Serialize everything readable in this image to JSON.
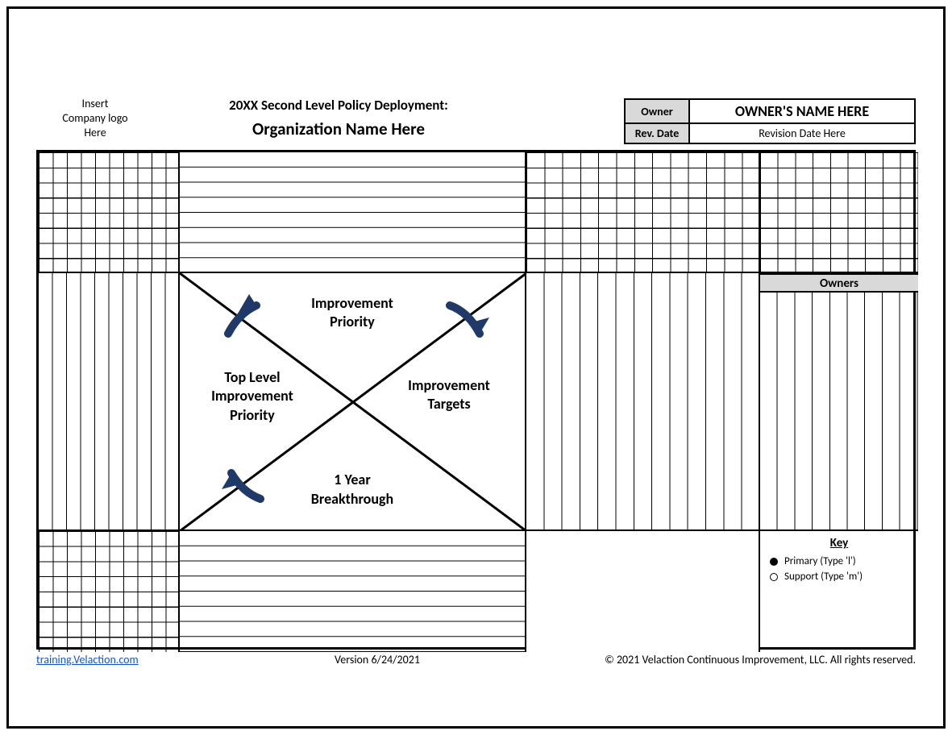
{
  "logo_hint": "Insert\nCompany logo\nHere",
  "header": {
    "title_line1": "20XX Second Level Policy Deployment:",
    "title_line2": "Organization Name Here"
  },
  "owner_box": {
    "owner_label": "Owner",
    "owner_value": "OWNER'S NAME HERE",
    "revdate_label": "Rev. Date",
    "revdate_value": "Revision Date Here"
  },
  "x_matrix": {
    "top": "Improvement\nPriority",
    "right": "Improvement\nTargets",
    "bottom": "1 Year\nBreakthrough",
    "left": "Top Level\nImprovement\nPriority"
  },
  "owners_header": "Owners",
  "key": {
    "title": "Key",
    "primary": "Primary (Type 'l')",
    "support": "Support (Type 'm')"
  },
  "footer": {
    "link_text": "training.Velaction.com",
    "version": "Version 6/24/2021",
    "copyright": "© 2021 Velaction Continuous Improvement, LLC. All rights reserved."
  },
  "colors": {
    "arrow": "#1f3a68"
  }
}
